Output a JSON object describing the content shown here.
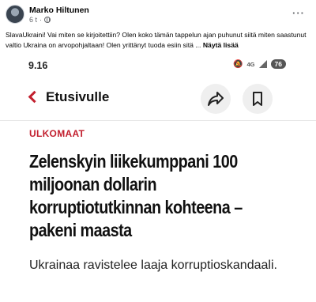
{
  "post": {
    "author": "Marko Hiltunen",
    "time": "6 t",
    "separator": "·",
    "text": "SlavaUkraini! Vai miten se kirjoitettiin? Olen koko tämän tappelun ajan puhunut siitä miten saastunut valtio Ukraina on arvopohjaltaan! Olen yrittänyt tuoda esiin sitä ...",
    "see_more": "Näytä lisää"
  },
  "screenshot": {
    "status": {
      "time": "9.16",
      "network": "4G",
      "battery": "76"
    },
    "nav": {
      "back_label": "Etusivulle"
    },
    "article": {
      "category": "ULKOMAAT",
      "headline": "Zelenskyin liikekumppani 100 miljoonan dollarin korruptiotutkinnan kohteena – pakeni maasta",
      "subheadline": "Ukrainaa ravistelee laaja korruptioskandaali."
    }
  },
  "colors": {
    "accent_red": "#c21f2e",
    "text_dark": "#111111",
    "muted": "#65676b"
  }
}
